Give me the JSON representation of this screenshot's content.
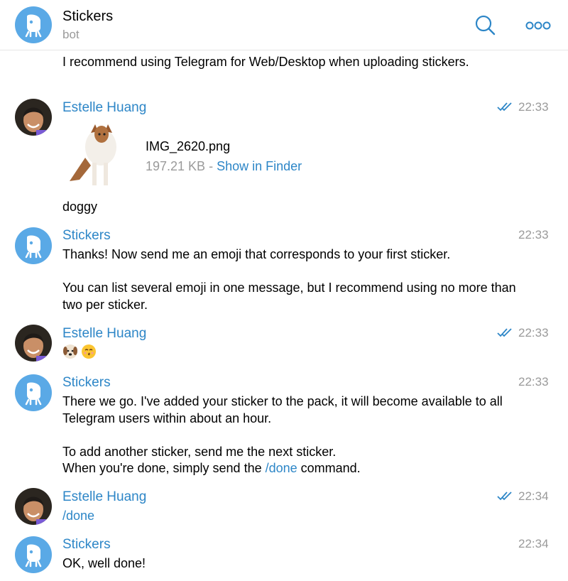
{
  "header": {
    "title": "Stickers",
    "subtitle": "bot"
  },
  "messages": {
    "intro_text": "I recommend using Telegram for Web/Desktop when uploading stickers.",
    "m1": {
      "sender": "Estelle Huang",
      "time": "22:33",
      "file_name": "IMG_2620.png",
      "file_size": "197.21 KB",
      "file_sep": " - ",
      "file_action": "Show in Finder",
      "caption": "doggy"
    },
    "m2": {
      "sender": "Stickers",
      "time": "22:33",
      "text": "Thanks! Now send me an emoji that corresponds to your first sticker.\n\nYou can list several emoji in one message, but I recommend using no more than two per sticker."
    },
    "m3": {
      "sender": "Estelle Huang",
      "time": "22:33",
      "emojis": [
        "dog-face-emoji",
        "kissing-face-emoji"
      ]
    },
    "m4": {
      "sender": "Stickers",
      "time": "22:33",
      "text": "There we go. I've added your sticker to the pack, it will become available to all Telegram users within about an hour.\n\nTo add another sticker, send me the next sticker.\nWhen you're done, simply send the ",
      "command": "/done",
      "text_end": " command."
    },
    "m5": {
      "sender": "Estelle Huang",
      "time": "22:34",
      "command": "/done"
    },
    "m6": {
      "sender": "Stickers",
      "time": "22:34",
      "text": "OK, well done!"
    }
  },
  "colors": {
    "accent": "#2d86c7",
    "bot_avatar": "#5aa9e6",
    "muted": "#9a9a9a"
  }
}
